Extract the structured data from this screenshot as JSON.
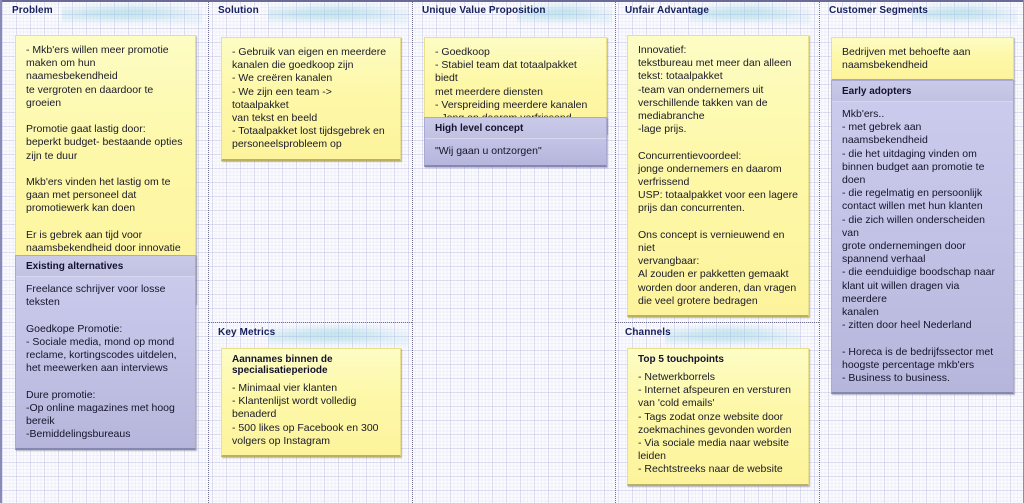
{
  "canvas": {
    "type": "lean-canvas",
    "grid_color": "#9696cd",
    "background": "#fbfbff",
    "note_yellow": "#fdf8a8",
    "note_purple": "#c2c2e6",
    "header_text_color": "#16205c"
  },
  "sections": {
    "problem": {
      "header": "Problem",
      "note": "- Mkb'ers willen meer promotie\nmaken om hun naamesbekendheid\nte vergroten en daardoor te groeien\n\nPromotie gaat lastig door:\nbeperkt budget- bestaande opties\nzijn te duur\n\nMkb'ers vinden het lastig om te\ngaan met personeel dat\npromotiewerk kan doen\n\nEr is gebrek aan tijd voor\nnaamsbekendheid door innovatie -\ndoor innovatie is er geen tijd voor\npromotie"
    },
    "existing_alternatives": {
      "header": "Existing alternatives",
      "note": "Freelance schrijver voor losse\nteksten\n\nGoedkope Promotie:\n- Sociale media, mond op mond\nreclame, kortingscodes uitdelen,\nhet meewerken aan interviews\n\nDure promotie:\n-Op online magazines met hoog\nbereik\n-Bemiddelingsbureaus"
    },
    "solution": {
      "header": "Solution",
      "note": "- Gebruik van eigen en meerdere\nkanalen die goedkoop zijn\n- We creëren kanalen\n- We zijn een team -> totaalpakket\nvan tekst en beeld\n- Totaalpakket lost tijdsgebrek en\npersoneelsprobleem op"
    },
    "key_metrics": {
      "header": "Key Metrics",
      "note_title": "Aannames binnen de\nspecialisatieperiode",
      "note": "- Minimaal vier klanten\n- Klantenlijst wordt volledig\nbenaderd\n- 500 likes op Facebook en 300\nvolgers op Instagram"
    },
    "unique_value_proposition": {
      "header": "Unique Value Proposition",
      "note": "- Goedkoop\n- Stabiel team dat totaalpakket biedt\nmet meerdere diensten\n- Verspreiding meerdere kanalen\n- Jong en daarom verfrissend"
    },
    "high_level_concept": {
      "header": "High level concept",
      "note": "\"Wij gaan u ontzorgen\""
    },
    "unfair_advantage": {
      "header": "Unfair Advantage",
      "note": "Innovatief:\ntekstbureau met meer dan alleen\ntekst: totaalpakket\n-team van ondernemers uit\nverschillende takken van de\nmediabranche\n-lage prijs.\n\nConcurrentievoordeel:\njonge ondernemers en daarom\nverfrissend\nUSP: totaalpakket voor een lagere\nprijs dan concurrenten.\n\nOns concept is vernieuwend en niet\nvervangbaar:\nAl zouden er pakketten gemaakt\nworden door anderen, dan vragen\ndie veel grotere bedragen"
    },
    "channels": {
      "header": "Channels",
      "note_title": "Top 5 touchpoints",
      "note": "- Netwerkborrels\n- Internet afspeuren en versturen\nvan 'cold emails'\n- Tags zodat onze website door\nzoekmachines gevonden worden\n- Via sociale media naar website\nleiden\n- Rechtstreeks naar de website"
    },
    "customer_segments": {
      "header": "Customer Segments",
      "note": "Bedrijven met behoefte aan\nnaamsbekendheid"
    },
    "early_adopters": {
      "header": "Early adopters",
      "note": "Mkb'ers..\n- met gebrek aan naamsbekendheid\n- die het uitdaging vinden om\nbinnen budget aan promotie te\ndoen\n- die regelmatig en persoonlijk\ncontact willen met hun klanten\n- die zich willen onderscheiden van\ngrote ondernemingen door\nspannend verhaal\n- die eenduidige boodschap naar\nklant uit willen dragen via meerdere\nkanalen\n- zitten door heel Nederland\n\n- Horeca is de bedrijfssector met\nhoogste percentage mkb'ers\n- Business to business."
    }
  }
}
